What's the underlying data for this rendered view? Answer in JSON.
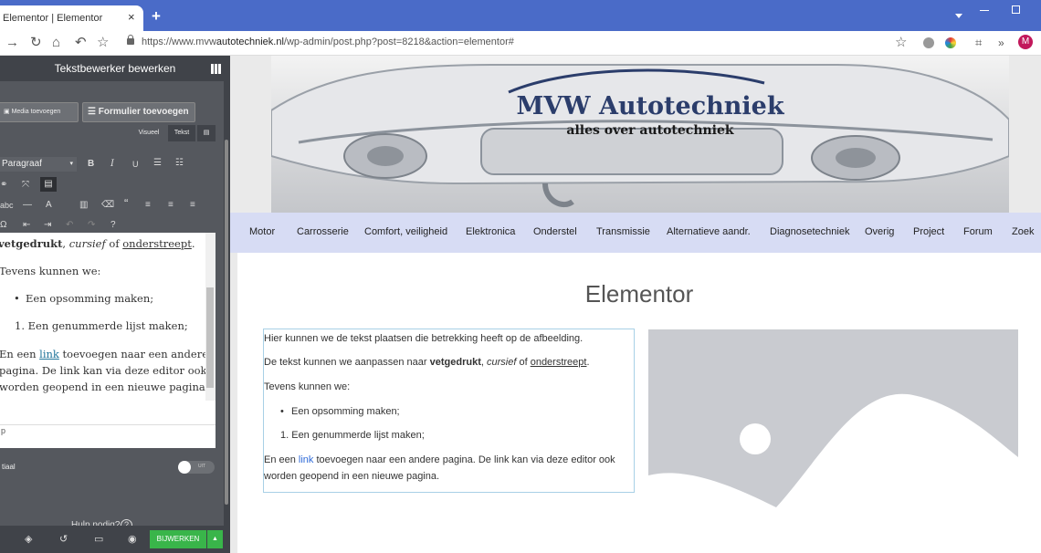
{
  "browser": {
    "tab_title": "Elementor | Elementor",
    "tab_close": "×",
    "new_tab": "+",
    "url_prefix": "https://www.mvw",
    "url_domain": "autotechniek.nl",
    "url_path": "/wp-admin/post.php?post=8218&action=elementor#",
    "avatar_letter": "M"
  },
  "panel": {
    "title": "Tekstbewerker bewerken",
    "add_media": "Media toevoegen",
    "add_form": "Formulier toevoegen",
    "tab_visual": "Visueel",
    "tab_text": "Tekst",
    "paragraph_select": "Paragraaf",
    "editor": {
      "line1_bold": "vetgedrukt",
      "line1_sep": ", ",
      "line1_italic": "cursief",
      "line1_of": " of ",
      "line1_underline": "onderstreept",
      "line1_end": ".",
      "line2": "Tevens kunnen we:",
      "bullet": "Een opsomming maken;",
      "numbered": "1. Een genummerde lijst maken;",
      "link_pre": "En een ",
      "link_text": "link",
      "link_post": " toevoegen naar een andere",
      "line_cont1": "pagina. De link kan via deze editor ook",
      "line_cont2": "worden geopend in een nieuwe pagina.",
      "status_path": "p"
    },
    "initial_label": "tiaal",
    "toggle_text": "UIT",
    "help_label": "Hulp nodig?",
    "update_button": "BIJWERKEN"
  },
  "preview": {
    "logo_title": "MVW Autotechniek",
    "logo_subtitle": "alles over autotechniek",
    "nav": [
      "Motor",
      "Carrosserie",
      "Comfort, veiligheid",
      "Elektronica",
      "Onderstel",
      "Transmissie",
      "Alternatieve aandr.",
      "Diagnosetechniek",
      "Overig",
      "Project",
      "Forum",
      "Zoek"
    ],
    "page_title": "Elementor",
    "text": {
      "p1": "Hier kunnen we de tekst plaatsen die betrekking heeft op de afbeelding.",
      "p2_pre": "De tekst kunnen we aanpassen naar ",
      "p2_bold": "vetgedrukt",
      "p2_sep": ", ",
      "p2_italic": "cursief",
      "p2_of": " of ",
      "p2_underline": "onderstreept",
      "p2_end": ".",
      "p3": "Tevens kunnen we:",
      "bullet": "Een opsomming maken;",
      "numbered": "1. Een genummerde lijst maken;",
      "p4_pre": "En een ",
      "p4_link": "link",
      "p4_post": " toevoegen naar een andere pagina. De link kan via deze editor ook",
      "p5": "worden geopend in een nieuwe pagina."
    }
  }
}
